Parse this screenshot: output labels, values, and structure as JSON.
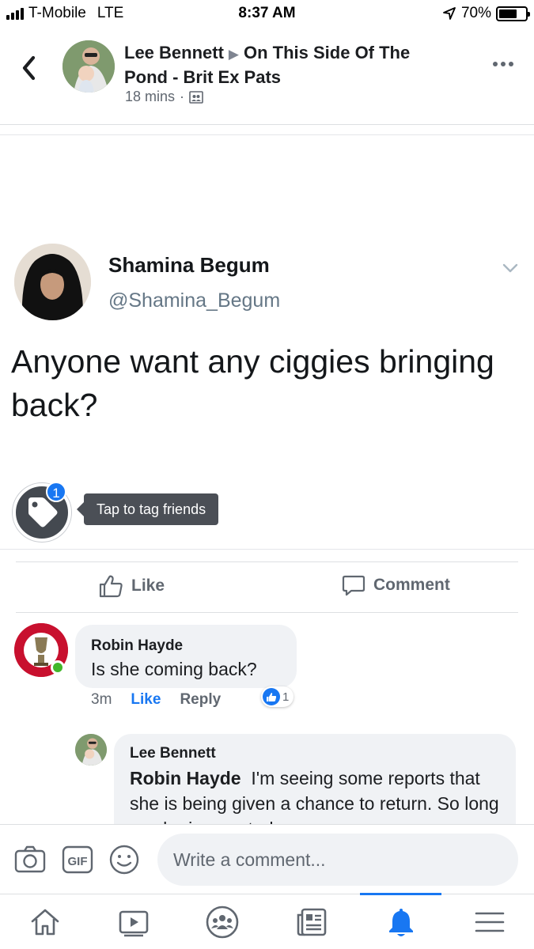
{
  "status_bar": {
    "carrier": "T-Mobile",
    "network": "LTE",
    "time": "8:37 AM",
    "battery_percent": "70%",
    "battery_level": 0.7,
    "signal_icon": "signal-bars-icon",
    "location_icon": "location-arrow-icon"
  },
  "post_header": {
    "author": "Lee Bennett",
    "group": "On This Side Of The Pond - Brit Ex Pats",
    "time": "18 mins",
    "audience_icon": "group-audience-icon"
  },
  "tweet": {
    "name": "Shamina Begum",
    "handle": "@Shamina_Begum",
    "text": "Anyone want any ciggies bringing back?"
  },
  "tag": {
    "badge_count": "1",
    "tooltip": "Tap to tag friends"
  },
  "actions": {
    "like_label": "Like",
    "comment_label": "Comment"
  },
  "comments": [
    {
      "author": "Robin Hayde",
      "text": "Is she coming back?",
      "time": "3m",
      "like_label": "Like",
      "reply_label": "Reply",
      "reaction_count": "1"
    },
    {
      "author": "Lee Bennett",
      "mention": "Robin Hayde",
      "text": "I'm seeing some reports that she is being given a chance to return. So long as she is arrested up on"
    }
  ],
  "composer": {
    "placeholder": "Write a comment..."
  },
  "bottom_nav": {
    "items": [
      "home-icon",
      "video-icon",
      "groups-icon",
      "news-feed-icon",
      "notifications-icon",
      "menu-icon"
    ],
    "active": "notifications-icon"
  },
  "colors": {
    "accent": "#1877f2",
    "text": "#1c1e21",
    "muted": "#606770",
    "bubble": "#f0f2f5",
    "online": "#42b72a"
  }
}
